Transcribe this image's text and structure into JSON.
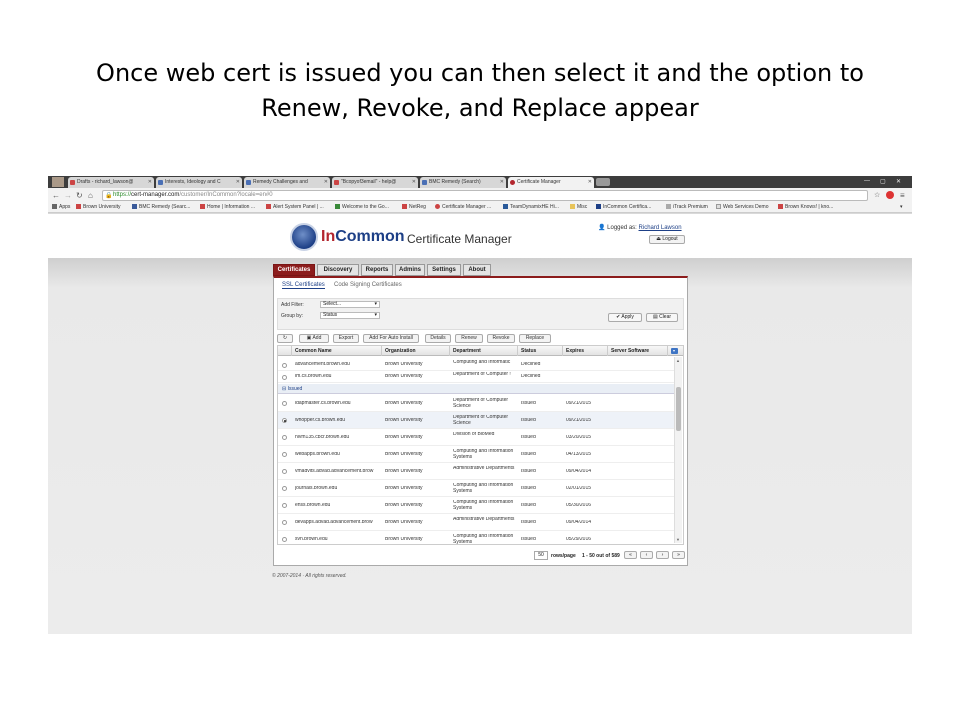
{
  "slide_title_line1": "Once web cert is issued you can then select it and the option to",
  "slide_title_line2": "Renew, Revoke, and Replace appear",
  "browser": {
    "tabs": [
      "Drafts - richard_lawson@",
      "Interests, Ideology and C",
      "Remedy Challenges and ",
      "\"Bcopyof3email\" - help@",
      "BMC Remedy (Search)",
      "Certificate Manager"
    ],
    "url_scheme": "https://",
    "url_host": "cert-manager.com",
    "url_path": "/customer/InCommon?locale=en#0",
    "bookmarks": [
      "Apps",
      "Brown University",
      "BMC Remedy (Searc...",
      "Home | Information ...",
      "Alert System Panel | ...",
      "Welcome to the Go...",
      "NetReg",
      "Certificate Manager ...",
      "TeamDynamixHE Hi...",
      "Misc",
      "InCommon Certifica...",
      "iTrack Premium",
      "Web Services Demo",
      "Brown Knows! | kno..."
    ]
  },
  "header": {
    "logo_in": "In",
    "logo_common": "Common",
    "subtitle": "Certificate Manager",
    "logged_label": "Logged as:",
    "user": "Richard Lawson",
    "logout": "Logout"
  },
  "main_tabs": [
    "Certificates",
    "Discovery",
    "Reports",
    "Admins",
    "Settings",
    "About"
  ],
  "sub_tabs": [
    "SSL Certificates",
    "Code Signing Certificates"
  ],
  "filter": {
    "add_filter_label": "Add Filter:",
    "add_filter_value": "Select...",
    "group_by_label": "Group by:",
    "group_by_value": "Status",
    "apply": "Apply",
    "clear": "Clear"
  },
  "toolbar": [
    "Add",
    "Export",
    "Add For Auto Install",
    "Details",
    "Renew",
    "Revoke",
    "Replace"
  ],
  "columns": [
    "Common Name",
    "Organization",
    "Department",
    "Status",
    "Expires",
    "Server Software"
  ],
  "rows_top": [
    {
      "cn": "advancement.brown.edu",
      "org": "Brown University",
      "dept": "Computing and Informatic",
      "status": "Declined",
      "expires": ""
    },
    {
      "cn": "im.cs.brown.edu",
      "org": "Brown University",
      "dept": "Department of Computer !",
      "status": "Declined",
      "expires": ""
    }
  ],
  "group_label": "Issued",
  "rows_issued": [
    {
      "cn": "ldapmaster.cs.brown.edu",
      "org": "Brown University",
      "dept": "Department of Computer Science",
      "status": "Issued",
      "expires": "09/21/2015"
    },
    {
      "cn": "whopper.cs.brown.edu",
      "org": "Brown University",
      "dept": "Department of Computer Science",
      "status": "Issued",
      "expires": "09/21/2015"
    },
    {
      "cn": "nlvm135.cbcr.brown.edu",
      "org": "Brown University",
      "dept": "Division of BioMed",
      "status": "Issued",
      "expires": "03/20/2015"
    },
    {
      "cn": "webapps.brown.edu",
      "org": "Brown University",
      "dept": "Computing and Information Systems",
      "status": "Issued",
      "expires": "04/13/2015"
    },
    {
      "cn": "vmadvlts.advad.advancement.brow",
      "org": "Brown University",
      "dept": "Administrative Departments",
      "status": "Issued",
      "expires": "09/04/2014"
    },
    {
      "cn": "journals.brown.edu",
      "org": "Brown University",
      "dept": "Computing and Information Systems",
      "status": "Issued",
      "expires": "02/01/2015"
    },
    {
      "cn": "ehss.brown.edu",
      "org": "Brown University",
      "dept": "Computing and Information Systems",
      "status": "Issued",
      "expires": "05/30/2016"
    },
    {
      "cn": "devapps.advad.advancement.brow",
      "org": "Brown University",
      "dept": "Administrative Departments",
      "status": "Issued",
      "expires": "09/04/2014"
    },
    {
      "cn": "svn.brown.edu",
      "org": "Brown University",
      "dept": "Computing and Information Systems",
      "status": "Issued",
      "expires": "05/29/2016"
    }
  ],
  "pager": {
    "rows": "50",
    "label": "rows/page",
    "range": "1 - 50 out of 589"
  },
  "copyright": "© 2007-2014 · All rights reserved."
}
